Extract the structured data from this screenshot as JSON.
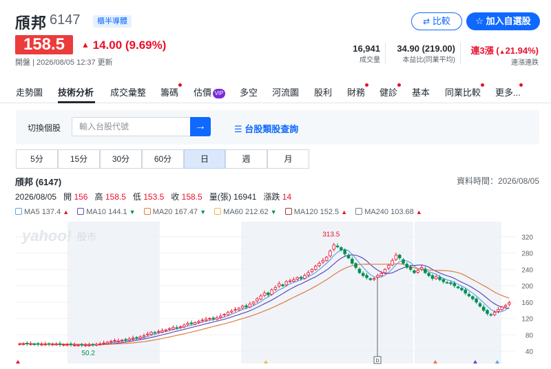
{
  "header": {
    "name": "頎邦",
    "code": "6147",
    "tag": "櫃半導體",
    "compare_label": "比較",
    "watchlist_label": "加入自選股"
  },
  "quote": {
    "price": "158.5",
    "change": "14.00 (9.69%)",
    "updated": "開盤 | 2026/08/05 12:37 更新",
    "volume": "16,941",
    "volume_label": "成交量",
    "pe": "34.90 (219.00)",
    "pe_label": "本益比(同業平均)",
    "streak": "連3漲 (",
    "streak_pct": "21.94%)",
    "streak_label": "連漲連跌"
  },
  "tabs": [
    {
      "label": "走勢圖"
    },
    {
      "label": "技術分析"
    },
    {
      "label": "成交彙整"
    },
    {
      "label": "籌碼"
    },
    {
      "label": "估價"
    },
    {
      "label": "多空"
    },
    {
      "label": "河流圖"
    },
    {
      "label": "股利"
    },
    {
      "label": "財務"
    },
    {
      "label": "健診"
    },
    {
      "label": "基本"
    },
    {
      "label": "同業比較"
    },
    {
      "label": "更多..."
    }
  ],
  "vip": "VIP",
  "search": {
    "label": "切換個股",
    "placeholder": "輸入台股代號",
    "category_link": "台股類股查詢"
  },
  "periods": [
    "5分",
    "15分",
    "30分",
    "60分",
    "日",
    "週",
    "月"
  ],
  "chart_info": {
    "title": "頎邦 (6147)",
    "time": "資料時間：2026/08/05",
    "date": "2026/08/05",
    "open_label": "開",
    "open": "156",
    "high_label": "高",
    "high": "158.5",
    "low_label": "低",
    "low": "153.5",
    "close_label": "收",
    "close": "158.5",
    "vol_label": "量(張)",
    "vol": "16941",
    "chg_label": "漲跌",
    "chg": "14"
  },
  "ma": [
    {
      "label": "MA5",
      "value": "137.4",
      "dir": "up",
      "color": "#5ba3e8"
    },
    {
      "label": "MA10",
      "value": "144.1",
      "dir": "dn",
      "color": "#5e4cb8"
    },
    {
      "label": "MA20",
      "value": "167.47",
      "dir": "dn",
      "color": "#e07a3f"
    },
    {
      "label": "MA60",
      "value": "212.62",
      "dir": "dn",
      "color": "#f3b94e"
    },
    {
      "label": "MA120",
      "value": "152.5",
      "dir": "up",
      "color": "#9a3b2b"
    },
    {
      "label": "MA240",
      "value": "103.68",
      "dir": "up",
      "color": "#7b8189"
    }
  ],
  "watermark": "yahoo!",
  "watermark_sub": "股市",
  "chart_data": {
    "type": "candlestick",
    "y_ticks": [
      "320",
      "280",
      "240",
      "200",
      "160",
      "120",
      "80",
      "40"
    ],
    "ylim": [
      20,
      340
    ],
    "annotations": {
      "high_label": "313.5",
      "low_label": "50.2",
      "marker": "D"
    },
    "colors": {
      "up": "#eb0f29",
      "down": "#008f50"
    },
    "close": [
      58,
      58,
      58,
      58,
      57,
      57,
      57,
      57,
      57,
      57,
      57,
      56,
      56,
      56,
      56,
      55,
      55,
      55,
      55,
      55,
      56,
      57,
      58,
      60,
      62,
      64,
      66,
      65,
      67,
      68,
      70,
      72,
      73,
      75,
      78,
      82,
      86,
      85,
      88,
      90,
      92,
      95,
      98,
      97,
      100,
      104,
      108,
      107,
      110,
      113,
      116,
      118,
      120,
      119,
      122,
      126,
      130,
      135,
      138,
      142,
      145,
      150,
      148,
      155,
      160,
      168,
      175,
      182,
      178,
      190,
      196,
      205,
      200,
      210,
      212,
      215,
      220,
      218,
      225,
      232,
      240,
      248,
      255,
      262,
      270,
      285,
      300,
      295,
      288,
      278,
      268,
      255,
      245,
      232,
      225,
      220,
      215,
      218,
      225,
      230,
      240,
      250,
      262,
      275,
      268,
      255,
      245,
      240,
      232,
      238,
      245,
      232,
      225,
      218,
      222,
      215,
      210,
      208,
      205,
      200,
      195,
      190,
      182,
      175,
      168,
      160,
      150,
      140,
      132,
      128,
      135,
      142,
      148,
      152,
      158.5
    ]
  }
}
